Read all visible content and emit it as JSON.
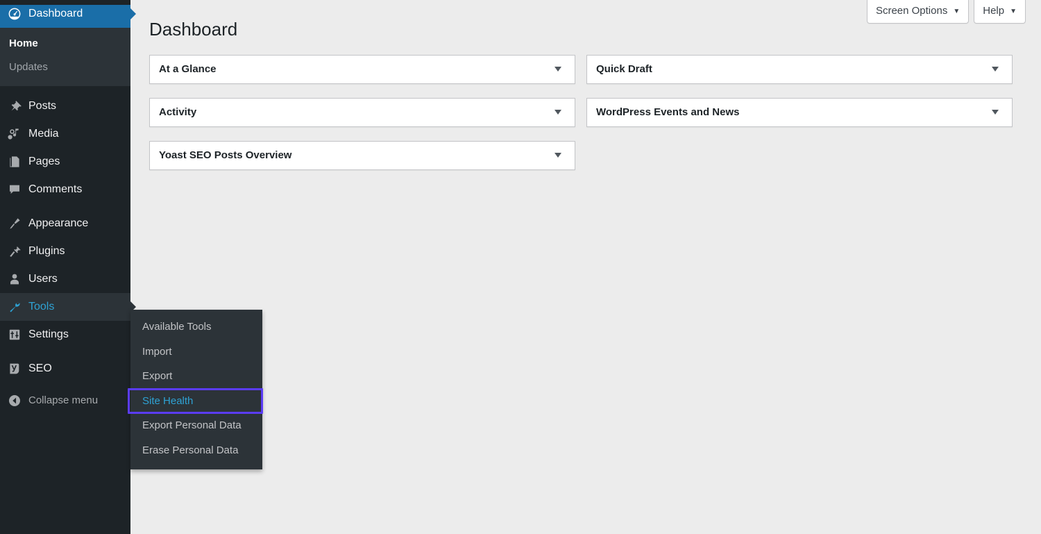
{
  "sidebar": {
    "top_item": {
      "label": "Dashboard",
      "icon": "dashboard-icon",
      "state": "current",
      "submenu": [
        {
          "label": "Home",
          "current": true
        },
        {
          "label": "Updates",
          "current": false
        }
      ]
    },
    "groups": [
      {
        "items": [
          {
            "label": "Posts",
            "icon": "pin-icon"
          },
          {
            "label": "Media",
            "icon": "media-icon"
          },
          {
            "label": "Pages",
            "icon": "pages-icon"
          },
          {
            "label": "Comments",
            "icon": "comments-icon"
          }
        ]
      },
      {
        "items": [
          {
            "label": "Appearance",
            "icon": "brush-icon"
          },
          {
            "label": "Plugins",
            "icon": "plug-icon"
          },
          {
            "label": "Users",
            "icon": "user-icon"
          },
          {
            "label": "Tools",
            "icon": "wrench-icon",
            "state": "open"
          },
          {
            "label": "Settings",
            "icon": "settings-icon"
          }
        ]
      },
      {
        "items": [
          {
            "label": "SEO",
            "icon": "yoast-seo-icon"
          }
        ]
      }
    ],
    "collapse": {
      "label": "Collapse menu",
      "icon": "collapse-arrow-icon"
    }
  },
  "flyout": {
    "parent": "Tools",
    "items": [
      {
        "label": "Available Tools",
        "focused": false
      },
      {
        "label": "Import",
        "focused": false
      },
      {
        "label": "Export",
        "focused": false
      },
      {
        "label": "Site Health",
        "focused": true
      },
      {
        "label": "Export Personal Data",
        "focused": false
      },
      {
        "label": "Erase Personal Data",
        "focused": false
      }
    ],
    "focus_outline_color": "#5b3cf5",
    "focus_text_color": "#2ea2d4"
  },
  "screen_meta": {
    "screen_options": "Screen Options",
    "help": "Help",
    "caret": "▼"
  },
  "page": {
    "title": "Dashboard"
  },
  "widgets": {
    "left": [
      {
        "title": "At a Glance"
      },
      {
        "title": "Activity"
      },
      {
        "title": "Yoast SEO Posts Overview"
      }
    ],
    "right": [
      {
        "title": "Quick Draft"
      },
      {
        "title": "WordPress Events and News"
      }
    ]
  },
  "colors": {
    "sidebar_bg": "#1d2327",
    "submenu_bg": "#2c3338",
    "current_blue": "#1a6ea8",
    "link_blue": "#2ea2d4",
    "content_bg": "#ececec",
    "widget_border": "#c3c4c7"
  }
}
